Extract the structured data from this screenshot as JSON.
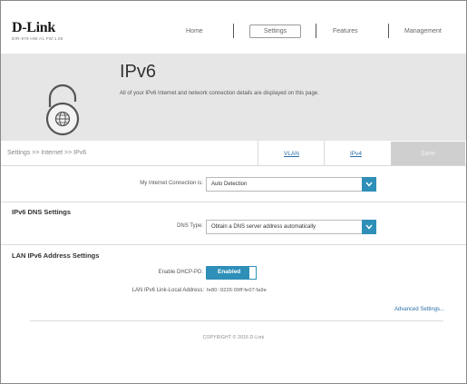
{
  "header": {
    "logo": "D-Link",
    "model": "DIR-879 HW:A1 FW:1.05",
    "nav": {
      "home": "Home",
      "settings": "Settings",
      "features": "Features",
      "management": "Management"
    }
  },
  "banner": {
    "title": "IPv6",
    "description": "All of your IPv6 Internet and network connection details are displayed on this page."
  },
  "toolbar": {
    "breadcrumb": "Settings >> Internet >> IPv6",
    "tabs": {
      "vlan": "VLAN",
      "ipv4": "IPv4"
    },
    "save_label": "Save"
  },
  "connection": {
    "label": "My Internet Connection is:",
    "value": "Auto Detection"
  },
  "dns": {
    "title": "IPv6 DNS Settings",
    "type_label": "DNS Type:",
    "type_value": "Obtain a DNS server address automatically"
  },
  "lan": {
    "title": "LAN IPv6 Address Settings",
    "dhcp_label": "Enable DHCP-PD:",
    "dhcp_value": "Enabled",
    "link_local_label": "LAN IPv6 Link-Local Address:",
    "link_local_value": "fe80::9226:09ff:fe07:fa9e"
  },
  "advanced_label": "Advanced Settings...",
  "footer": {
    "copyright": "COPYRIGHT © 2016 D-Link"
  },
  "colors": {
    "accent": "#2e8fb8",
    "banner_bg": "#e6e6e6",
    "link": "#2b6fa8"
  }
}
